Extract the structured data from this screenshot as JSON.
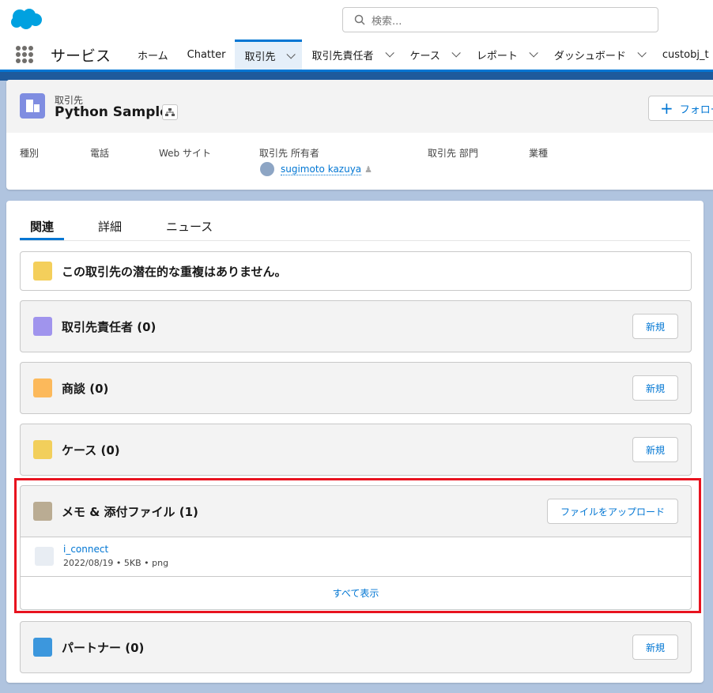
{
  "header": {
    "search_placeholder": "検索...",
    "app_name": "サービス"
  },
  "nav": [
    {
      "label": "ホーム",
      "chevron": false
    },
    {
      "label": "Chatter",
      "chevron": false
    },
    {
      "label": "取引先",
      "chevron": true,
      "active": true
    },
    {
      "label": "取引先責任者",
      "chevron": true
    },
    {
      "label": "ケース",
      "chevron": true
    },
    {
      "label": "レポート",
      "chevron": true
    },
    {
      "label": "ダッシュボード",
      "chevron": true
    },
    {
      "label": "custobj_t",
      "chevron": false
    }
  ],
  "record": {
    "object": "取引先",
    "name": "Python Sample",
    "follow": "フォロー",
    "fields": [
      "種別",
      "電話",
      "Web サイト",
      "取引先 所有者",
      "取引先 部門",
      "業種"
    ],
    "owner": "sugimoto kazuya"
  },
  "tabs": [
    "関連",
    "詳細",
    "ニュース"
  ],
  "duplicates": "この取引先の潜在的な重複はありません。",
  "sections": {
    "contacts": {
      "title": "取引先責任者 (0)",
      "button": "新規",
      "color": "#a094ed"
    },
    "opportunities": {
      "title": "商談 (0)",
      "button": "新規",
      "color": "#fcb95b"
    },
    "cases": {
      "title": "ケース (0)",
      "button": "新規",
      "color": "#f2cf5b"
    },
    "notes": {
      "title": "メモ & 添付ファイル (1)",
      "button": "ファイルをアップロード",
      "color": "#baac93",
      "file": {
        "name": "i_connect",
        "date": "2022/08/19",
        "size": "5KB",
        "type": "png"
      },
      "view_all": "すべて表示"
    },
    "partners": {
      "title": "パートナー (0)",
      "button": "新規",
      "color": "#3c97dd"
    }
  },
  "colors": {
    "brand": "#0176d3",
    "highlight": "#e8131f"
  }
}
